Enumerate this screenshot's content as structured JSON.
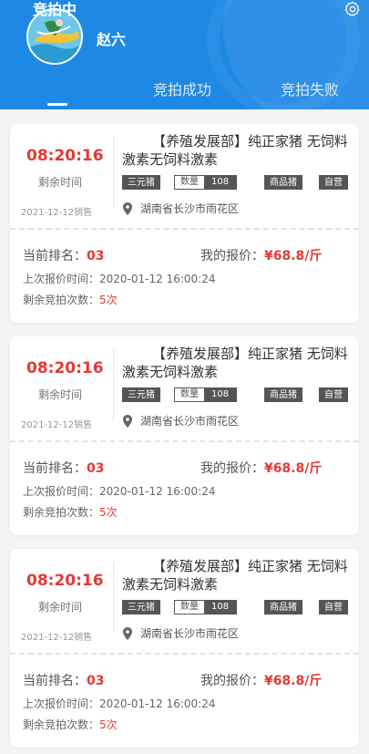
{
  "header": {
    "username": "赵六",
    "settings_icon": "gear-icon",
    "avatar": "avatar-image",
    "bg_color": "#1e88e5"
  },
  "tabs": [
    {
      "label": "竞拍中",
      "active": true
    },
    {
      "label": "竞拍成功",
      "active": false
    },
    {
      "label": "竞拍失败",
      "active": false
    }
  ],
  "cards": [
    {
      "countdown": "08:20:16",
      "countdown_label": "剩余时间",
      "sale_date": "2021-12-12销售",
      "title": "【养殖发展部】纯正家猪 无饲料激素无饲料激素",
      "tags": {
        "breed": "三元猪",
        "qty_label": "数量",
        "qty_value": "108",
        "type": "商品猪",
        "owner": "自营"
      },
      "location": "湖南省长沙市雨花区",
      "rank_label": "当前排名：",
      "rank_value": "03",
      "offer_label": "我的报价：",
      "offer_value": "¥68.8/斤",
      "last_label": "上次报价时间：",
      "last_value": "2020-01-12  16:00:24",
      "remaining_label": "剩余竞拍次数：",
      "remaining_value": "5次"
    },
    {
      "countdown": "08:20:16",
      "countdown_label": "剩余时间",
      "sale_date": "2021-12-12销售",
      "title": "【养殖发展部】纯正家猪 无饲料激素无饲料激素",
      "tags": {
        "breed": "三元猪",
        "qty_label": "数量",
        "qty_value": "108",
        "type": "商品猪",
        "owner": "自营"
      },
      "location": "湖南省长沙市雨花区",
      "rank_label": "当前排名：",
      "rank_value": "03",
      "offer_label": "我的报价：",
      "offer_value": "¥68.8/斤",
      "last_label": "上次报价时间：",
      "last_value": "2020-01-12  16:00:24",
      "remaining_label": "剩余竞拍次数：",
      "remaining_value": "5次"
    },
    {
      "countdown": "08:20:16",
      "countdown_label": "剩余时间",
      "sale_date": "2021-12-12销售",
      "title": "【养殖发展部】纯正家猪 无饲料激素无饲料激素",
      "tags": {
        "breed": "三元猪",
        "qty_label": "数量",
        "qty_value": "108",
        "type": "商品猪",
        "owner": "自营"
      },
      "location": "湖南省长沙市雨花区",
      "rank_label": "当前排名：",
      "rank_value": "03",
      "offer_label": "我的报价：",
      "offer_value": "¥68.8/斤",
      "last_label": "上次报价时间：",
      "last_value": "2020-01-12  16:00:24",
      "remaining_label": "剩余竞拍次数：",
      "remaining_value": "5次"
    }
  ]
}
